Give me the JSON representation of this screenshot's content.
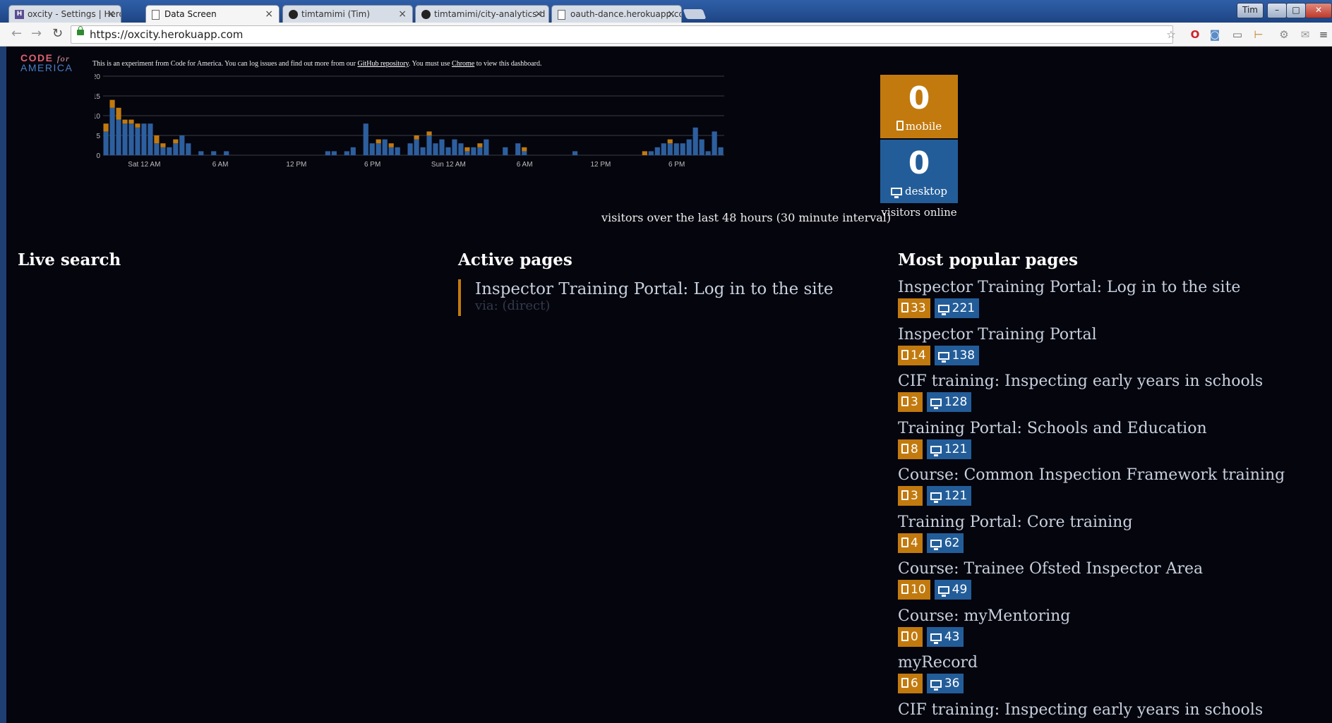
{
  "browser": {
    "tabs": [
      {
        "title": "oxcity - Settings | Heroku",
        "active": false,
        "icon": "heroku-icon"
      },
      {
        "title": "Data Screen",
        "active": true,
        "icon": "page-icon"
      },
      {
        "title": "timtamimi (Tim)",
        "active": false,
        "icon": "github-icon"
      },
      {
        "title": "timtamimi/city-analytics-d",
        "active": false,
        "icon": "github-icon"
      },
      {
        "title": "oauth-dance.herokuapp.co",
        "active": false,
        "icon": "page-icon"
      }
    ],
    "user": "Tim",
    "url": "https://oxcity.herokuapp.com"
  },
  "header": {
    "logo_line1": "CODE",
    "logo_for": "for",
    "logo_line2": "AMERICA",
    "intro_before": "This is an experiment from Code for America. You can log issues and find out more from our ",
    "intro_link1": "GitHub repository",
    "intro_middle": ". You must use ",
    "intro_link2": "Chrome",
    "intro_after": " to view this dashboard."
  },
  "chart_data": {
    "type": "bar",
    "stacked": true,
    "yticks": [
      0,
      5,
      10,
      15,
      20
    ],
    "ylim": [
      0,
      20
    ],
    "xticks": [
      "Sat 12 AM",
      "6 AM",
      "12 PM",
      "6 PM",
      "Sun 12 AM",
      "6 AM",
      "12 PM",
      "6 PM"
    ],
    "xtick_positions": [
      6,
      18,
      30,
      42,
      54,
      66,
      78,
      90
    ],
    "caption": "visitors over the last 48 hours (30 minute interval)",
    "series": [
      {
        "color": "#2d5f9e",
        "values": [
          6,
          12,
          9,
          8,
          8,
          7,
          8,
          8,
          3,
          2,
          2,
          3,
          5,
          3,
          0,
          1,
          0,
          1,
          0,
          1,
          0,
          0,
          0,
          0,
          0,
          0,
          0,
          0,
          0,
          0,
          0,
          0,
          0,
          0,
          0,
          1,
          1,
          0,
          1,
          2,
          0,
          8,
          3,
          3,
          4,
          2,
          2,
          0,
          3,
          4,
          2,
          5,
          3,
          4,
          2,
          4,
          3,
          1,
          2,
          2,
          4,
          0,
          0,
          2,
          0,
          3,
          1,
          0,
          0,
          0,
          0,
          0,
          0,
          0,
          1,
          0,
          0,
          0,
          0,
          0,
          0,
          0,
          0,
          0,
          0,
          0,
          1,
          2,
          3,
          3,
          3,
          3,
          4,
          7,
          4,
          1,
          6,
          2
        ]
      },
      {
        "color": "#c27a0e",
        "values": [
          2,
          2,
          3,
          1,
          1,
          1,
          0,
          0,
          2,
          1,
          0,
          1,
          0,
          0,
          0,
          0,
          0,
          0,
          0,
          0,
          0,
          0,
          0,
          0,
          0,
          0,
          0,
          0,
          0,
          0,
          0,
          0,
          0,
          0,
          0,
          0,
          0,
          0,
          0,
          0,
          0,
          0,
          0,
          1,
          0,
          1,
          0,
          0,
          0,
          1,
          0,
          1,
          0,
          0,
          0,
          0,
          0,
          1,
          0,
          1,
          0,
          0,
          0,
          0,
          0,
          0,
          1,
          0,
          0,
          0,
          0,
          0,
          0,
          0,
          0,
          0,
          0,
          0,
          0,
          0,
          0,
          0,
          0,
          0,
          0,
          1,
          0,
          0,
          0,
          1,
          0,
          0,
          0,
          0,
          0,
          0,
          0,
          0
        ]
      }
    ]
  },
  "stats": {
    "mobile_count": "0",
    "mobile_label": "mobile",
    "desktop_count": "0",
    "desktop_label": "desktop",
    "caption": "visitors online"
  },
  "live_search": {
    "title": "Live search"
  },
  "active_pages": {
    "title": "Active pages",
    "items": [
      {
        "title": "Inspector Training Portal: Log in to the site",
        "via": "via: (direct)"
      }
    ]
  },
  "popular_pages": {
    "title": "Most popular pages",
    "items": [
      {
        "title": "Inspector Training Portal: Log in to the site",
        "mobile": "33",
        "desktop": "221"
      },
      {
        "title": "Inspector Training Portal",
        "mobile": "14",
        "desktop": "138"
      },
      {
        "title": "CIF training: Inspecting early years in schools",
        "mobile": "3",
        "desktop": "128"
      },
      {
        "title": "Training Portal: Schools and Education",
        "mobile": "8",
        "desktop": "121"
      },
      {
        "title": "Course: Common Inspection Framework training",
        "mobile": "3",
        "desktop": "121"
      },
      {
        "title": "Training Portal: Core training",
        "mobile": "4",
        "desktop": "62"
      },
      {
        "title": "Course: Trainee Ofsted Inspector Area",
        "mobile": "10",
        "desktop": "49"
      },
      {
        "title": "Course: myMentoring",
        "mobile": "0",
        "desktop": "43"
      },
      {
        "title": "myRecord",
        "mobile": "6",
        "desktop": "36"
      },
      {
        "title": "CIF training: Inspecting early years in schools",
        "mobile": "",
        "desktop": ""
      }
    ]
  }
}
